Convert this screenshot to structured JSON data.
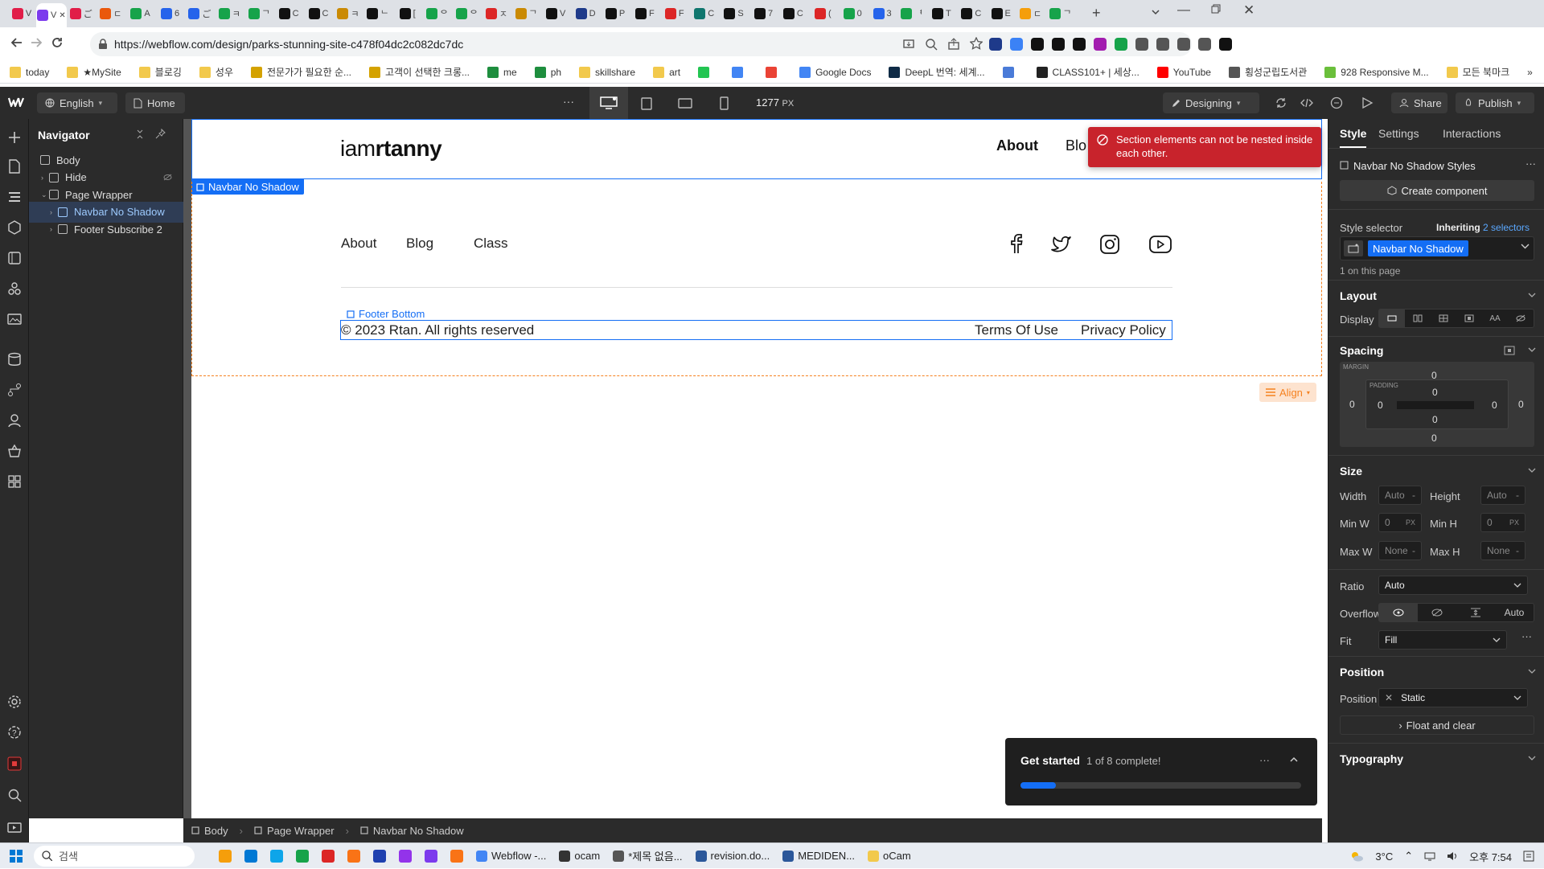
{
  "browser": {
    "tabs": [
      {
        "label": "V",
        "active": false
      },
      {
        "label": "V",
        "active": true
      },
      {
        "label": "ご",
        "active": false
      },
      {
        "label": "ㄷ",
        "active": false
      },
      {
        "label": "A",
        "active": false
      },
      {
        "label": "6",
        "active": false
      },
      {
        "label": "ご",
        "active": false
      },
      {
        "label": "ㅋ",
        "active": false
      },
      {
        "label": "ᄀ",
        "active": false
      },
      {
        "label": "C",
        "active": false
      },
      {
        "label": "C",
        "active": false
      },
      {
        "label": "ㅋ",
        "active": false
      },
      {
        "label": "ᄂ",
        "active": false
      },
      {
        "label": "[",
        "active": false
      },
      {
        "label": "ᄋ",
        "active": false
      },
      {
        "label": "ᄋ",
        "active": false
      },
      {
        "label": "ㅈ",
        "active": false
      },
      {
        "label": "ᄀ",
        "active": false
      },
      {
        "label": "V",
        "active": false
      },
      {
        "label": "D",
        "active": false
      },
      {
        "label": "P",
        "active": false
      },
      {
        "label": "F",
        "active": false
      },
      {
        "label": "F",
        "active": false
      },
      {
        "label": "C",
        "active": false
      },
      {
        "label": "S",
        "active": false
      },
      {
        "label": "7",
        "active": false
      },
      {
        "label": "C",
        "active": false
      },
      {
        "label": "(",
        "active": false
      },
      {
        "label": "0",
        "active": false
      },
      {
        "label": "3",
        "active": false
      },
      {
        "label": "ᅧ",
        "active": false
      },
      {
        "label": "T",
        "active": false
      },
      {
        "label": "C",
        "active": false
      },
      {
        "label": "E",
        "active": false
      },
      {
        "label": "ㄷ",
        "active": false
      },
      {
        "label": "ᄀ",
        "active": false
      }
    ],
    "new_tab": "+",
    "url": "https://webflow.com/design/parks-stunning-site-c478f04dc2c082dc7dc",
    "bookmarks": [
      {
        "label": "today",
        "color": "#f2c94c"
      },
      {
        "label": "★MySite",
        "color": "#f2c94c"
      },
      {
        "label": "블로깅",
        "color": "#f2c94c"
      },
      {
        "label": "성우",
        "color": "#f2c94c"
      },
      {
        "label": "전문가가 필요한 순...",
        "color": "#d4a200"
      },
      {
        "label": "고객이 선택한 크롱...",
        "color": "#d4a200"
      },
      {
        "label": "me",
        "color": "#1e8e3e"
      },
      {
        "label": "ph",
        "color": "#1e8e3e"
      },
      {
        "label": "skillshare",
        "color": "#f2c94c"
      },
      {
        "label": "art",
        "color": "#f2c94c"
      },
      {
        "label": "",
        "color": "#23c552"
      },
      {
        "label": "",
        "color": "#4285f4"
      },
      {
        "label": "",
        "color": "#ea4335"
      },
      {
        "label": "Google Docs",
        "color": "#4285f4"
      },
      {
        "label": "DeepL 번역: 세계...",
        "color": "#0f2b46"
      },
      {
        "label": "",
        "color": "#4a7bd8"
      },
      {
        "label": "CLASS101+ | 세상...",
        "color": "#222"
      },
      {
        "label": "YouTube",
        "color": "#ff0000"
      },
      {
        "label": "횡성군립도서관",
        "color": "#555"
      },
      {
        "label": "928 Responsive M...",
        "color": "#6abf3b"
      },
      {
        "label": "모든 북마크",
        "color": "#f2c94c"
      }
    ],
    "more_bookmarks": "»"
  },
  "webflow": {
    "locale": "English",
    "page": "Home",
    "more": "···",
    "width_value": "1277",
    "width_unit": "PX",
    "mode": "Designing",
    "share": "Share",
    "publish": "Publish"
  },
  "navigator": {
    "title": "Navigator",
    "items": [
      {
        "label": "Body",
        "indent": 0,
        "selected": false
      },
      {
        "label": "Hide",
        "indent": 1,
        "selected": false
      },
      {
        "label": "Page Wrapper",
        "indent": 1,
        "selected": false
      },
      {
        "label": "Navbar No Shadow",
        "indent": 2,
        "selected": true
      },
      {
        "label": "Footer Subscribe 2",
        "indent": 2,
        "selected": false
      }
    ]
  },
  "canvas": {
    "logo_prefix": "iam",
    "logo_bold": "rtanny",
    "nav_links": [
      "About",
      "Blo"
    ],
    "selected_tag": "Navbar No Shadow",
    "toast": "Section elements can not be nested inside each other.",
    "footer_links": [
      "About",
      "Blog",
      "Class"
    ],
    "footer_bottom_tag": "Footer Bottom",
    "copyright": "© 2023 Rtan. All rights reserved",
    "legal_links": [
      "Terms Of Use",
      "Privacy Policy"
    ],
    "align_button": "Align",
    "get_started": {
      "title": "Get started",
      "progress_text": "1 of 8 complete!",
      "completed": 1,
      "total": 8
    }
  },
  "breadcrumbs": [
    "Body",
    "Page Wrapper",
    "Navbar No Shadow"
  ],
  "style_panel": {
    "tabs": [
      "Style",
      "Settings",
      "Interactions"
    ],
    "styles_title": "Navbar No Shadow Styles",
    "create_component": "Create component",
    "style_selector_label": "Style selector",
    "inheriting_prefix": "Inheriting",
    "inheriting_count": "2 selectors",
    "selector_chip": "Navbar No Shadow",
    "on_page": "1 on this page",
    "layout_title": "Layout",
    "display_label": "Display",
    "spacing_title": "Spacing",
    "margin_label": "MARGIN",
    "padding_label": "PADDING",
    "margin": {
      "top": "0",
      "right": "0",
      "bottom": "0",
      "left": "0"
    },
    "padding": {
      "top": "0",
      "right": "0",
      "bottom": "0",
      "left": "0"
    },
    "size_title": "Size",
    "width_label": "Width",
    "width_value": "Auto",
    "height_label": "Height",
    "height_value": "Auto",
    "minw_label": "Min W",
    "minw_value": "0",
    "minw_unit": "PX",
    "minh_label": "Min H",
    "minh_value": "0",
    "minh_unit": "PX",
    "maxw_label": "Max W",
    "maxw_value": "None",
    "maxh_label": "Max H",
    "maxh_value": "None",
    "unit_dash": "-",
    "ratio_label": "Ratio",
    "ratio_value": "Auto",
    "overflow_label": "Overflow",
    "overflow_auto": "Auto",
    "fit_label": "Fit",
    "fit_value": "Fill",
    "position_title": "Position",
    "position_label": "Position",
    "position_value": "Static",
    "float_clear": "Float and clear",
    "typography_title": "Typography"
  },
  "taskbar": {
    "search_placeholder": "검색",
    "apps": [
      "Webflow -...",
      "ocam",
      "*제목 없음...",
      "revision.do...",
      "MEDIDEN...",
      "oCam"
    ],
    "weather": "3°C",
    "clock": "오후 7:54"
  },
  "colors": {
    "accent": "#146ef5",
    "toast_bg": "#c8232c",
    "align_orange": "#f5811f",
    "panel_bg": "#2b2b2b"
  }
}
